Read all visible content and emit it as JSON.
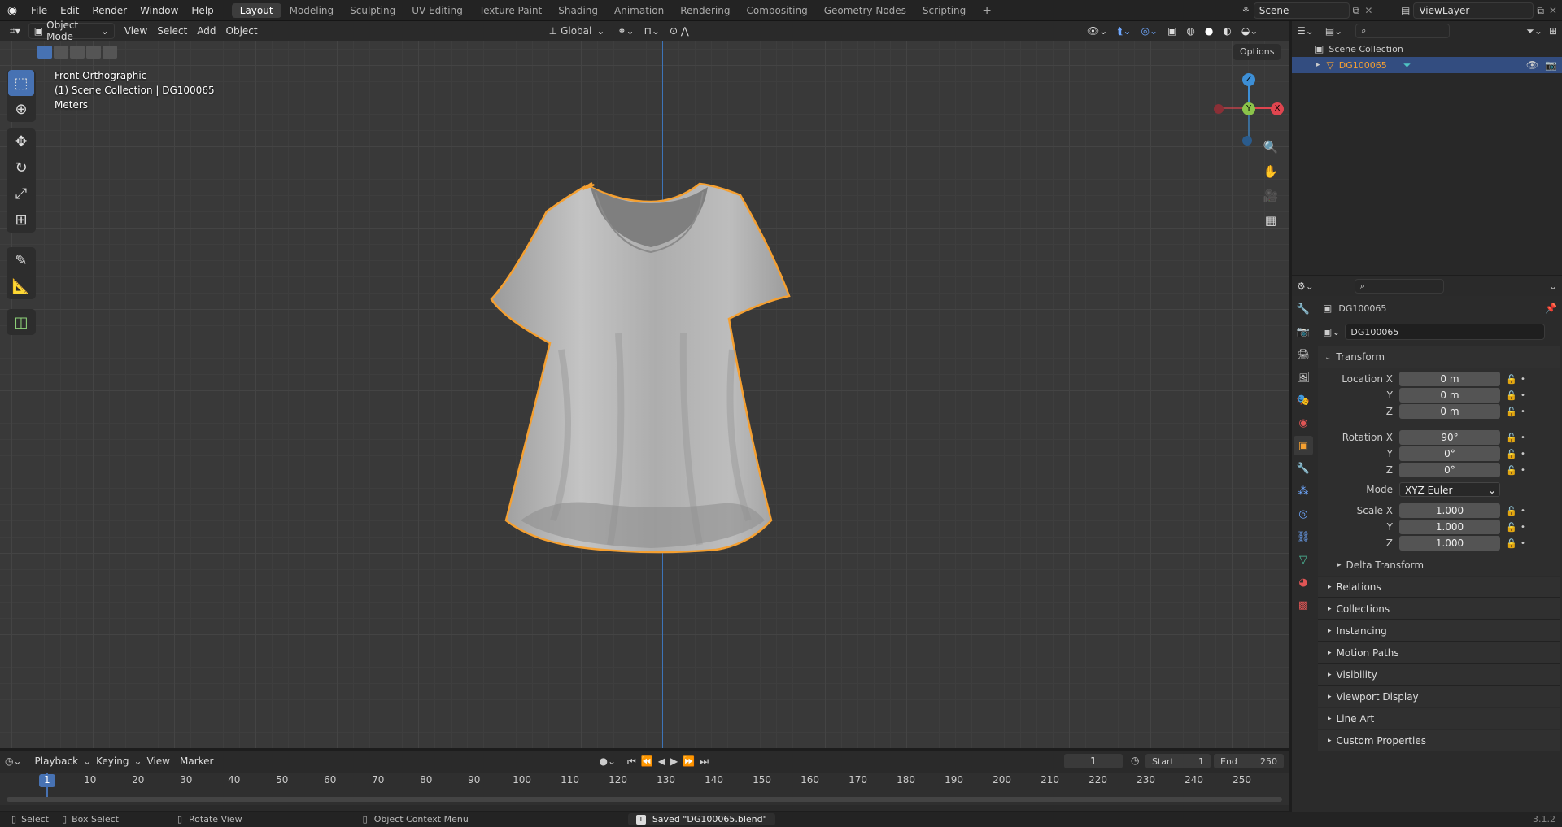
{
  "topbar": {
    "menus": [
      "File",
      "Edit",
      "Render",
      "Window",
      "Help"
    ],
    "workspaces": [
      "Layout",
      "Modeling",
      "Sculpting",
      "UV Editing",
      "Texture Paint",
      "Shading",
      "Animation",
      "Rendering",
      "Compositing",
      "Geometry Nodes",
      "Scripting"
    ],
    "active_workspace": "Layout",
    "add_tab": "+",
    "scene": "Scene",
    "view_layer": "ViewLayer"
  },
  "viewport_header": {
    "mode": "Object Mode",
    "menus": [
      "View",
      "Select",
      "Add",
      "Object"
    ],
    "orientation": "Global",
    "options": "Options"
  },
  "viewport": {
    "view_name": "Front Orthographic",
    "collection_info": "(1) Scene Collection | DG100065",
    "units": "Meters",
    "gizmo": {
      "z": "Z",
      "y": "Y",
      "x": "X"
    }
  },
  "outliner": {
    "root": "Scene Collection",
    "object": "DG100065"
  },
  "properties": {
    "object_name": "DG100065",
    "datablock": "DG100065",
    "transform_title": "Transform",
    "location": {
      "label": "Location X",
      "x": "0 m",
      "y": "0 m",
      "z": "0 m"
    },
    "rotation": {
      "label": "Rotation X",
      "x": "90°",
      "y": "0°",
      "z": "0°"
    },
    "mode_label": "Mode",
    "mode_value": "XYZ Euler",
    "scale": {
      "label": "Scale X",
      "x": "1.000",
      "y": "1.000",
      "z": "1.000"
    },
    "axis_y": "Y",
    "axis_z": "Z",
    "delta": "Delta Transform",
    "panels": [
      "Relations",
      "Collections",
      "Instancing",
      "Motion Paths",
      "Visibility",
      "Viewport Display",
      "Line Art",
      "Custom Properties"
    ]
  },
  "timeline": {
    "menus": [
      "Playback",
      "Keying",
      "View",
      "Marker"
    ],
    "current_frame": "1",
    "start_label": "Start",
    "start": "1",
    "end_label": "End",
    "end": "250",
    "ticks": [
      "1",
      "10",
      "20",
      "30",
      "40",
      "50",
      "60",
      "70",
      "80",
      "90",
      "100",
      "110",
      "120",
      "130",
      "140",
      "150",
      "160",
      "170",
      "180",
      "190",
      "200",
      "210",
      "220",
      "230",
      "240",
      "250"
    ]
  },
  "statusbar": {
    "select": "Select",
    "box_select": "Box Select",
    "rotate_view": "Rotate View",
    "context_menu": "Object Context Menu",
    "message": "Saved \"DG100065.blend\"",
    "version": "3.1.2"
  },
  "colors": {
    "accent": "#4772b3",
    "selection_outline": "#f5a031",
    "axis_x": "#e0454f",
    "axis_y": "#8bc34a",
    "axis_z": "#3d8fd6"
  }
}
